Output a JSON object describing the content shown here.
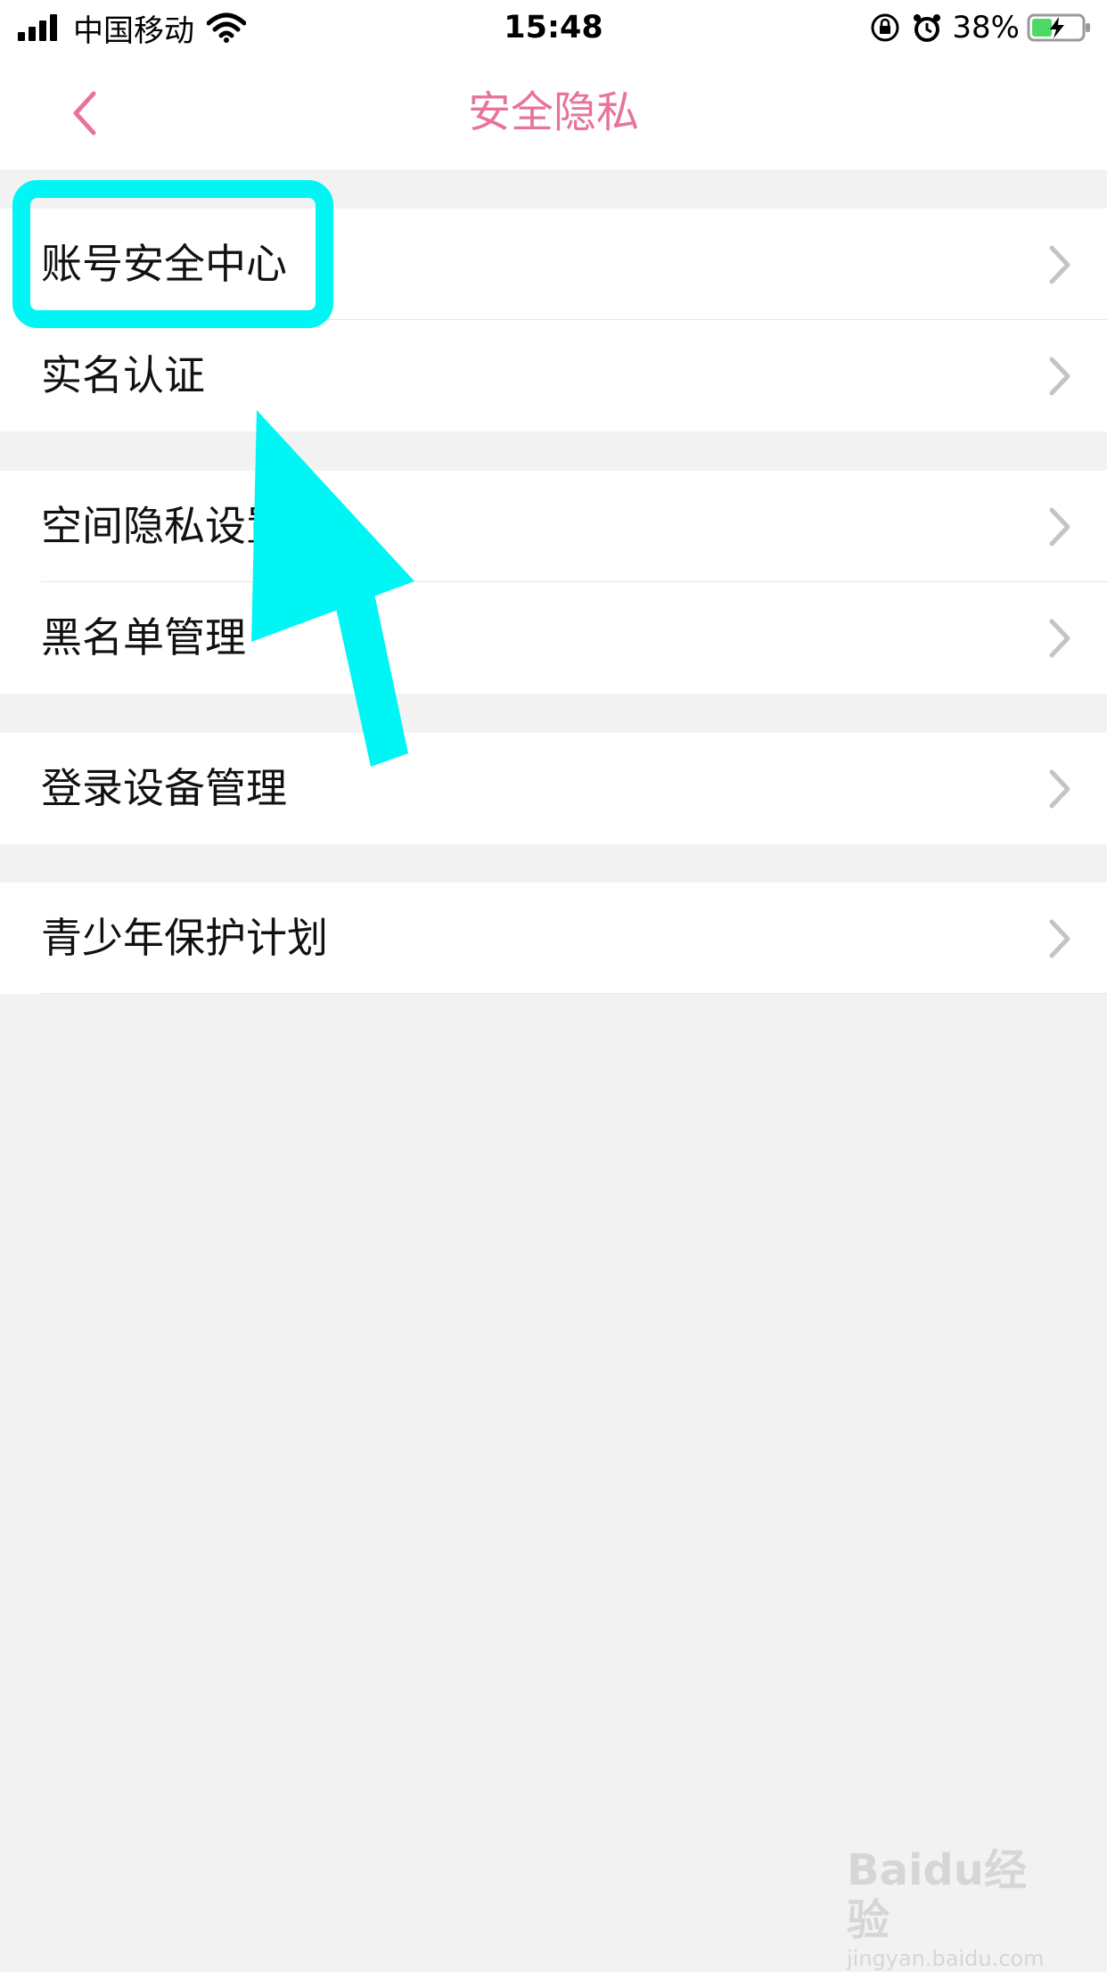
{
  "status_bar": {
    "carrier": "中国移动",
    "time": "15:48",
    "battery": "38%",
    "icons": [
      "signal-icon",
      "wifi-icon",
      "rotation-lock-icon",
      "alarm-icon",
      "battery-charging-icon"
    ]
  },
  "nav": {
    "title": "安全隐私",
    "back_icon": "chevron-left-icon"
  },
  "groups": [
    {
      "items": [
        {
          "label": "账号安全中心"
        },
        {
          "label": "实名认证"
        }
      ]
    },
    {
      "items": [
        {
          "label": "空间隐私设置"
        },
        {
          "label": "黑名单管理"
        }
      ]
    },
    {
      "items": [
        {
          "label": "登录设备管理"
        }
      ]
    },
    {
      "items": [
        {
          "label": "青少年保护计划"
        }
      ]
    }
  ],
  "colors": {
    "accent": "#e8739a",
    "highlight": "#00f5f5",
    "background": "#f2f2f2"
  },
  "watermark": {
    "main": "Baidu经验",
    "sub": "jingyan.baidu.com"
  }
}
